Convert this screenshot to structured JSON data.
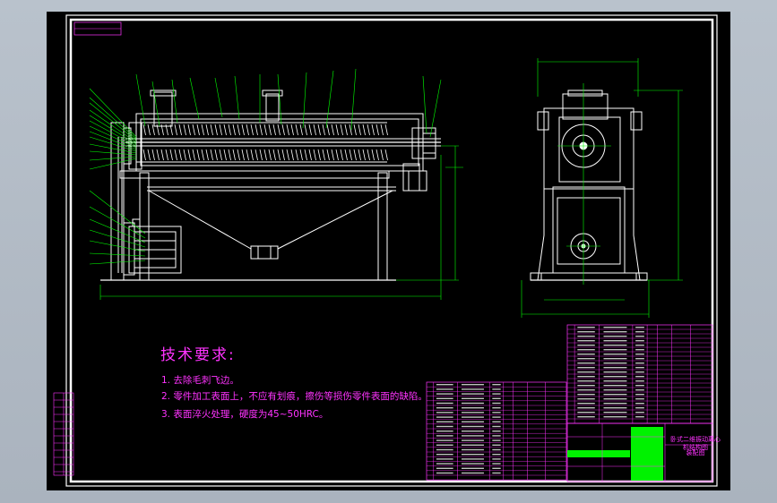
{
  "window": {
    "viewport_bg": "#000000",
    "frame_color": "#ffffff",
    "drawing_color": "#ffffff",
    "dimension_color": "#00ff00",
    "leader_color": "#00ff00",
    "text_color": "#ff33ff",
    "highlight_color": "#00ff00"
  },
  "tech_requirements": {
    "title": "技术要求:",
    "items": [
      "1. 去除毛刺飞边。",
      "2. 零件加工表面上，不应有划痕，擦伤等损伤零件表面的缺陷。",
      "3. 表面淬火处理，硬度为45~50HRC。"
    ]
  },
  "title_block": {
    "name": "卧式二维振动离心机结构图",
    "drawing_no": "装配图"
  }
}
